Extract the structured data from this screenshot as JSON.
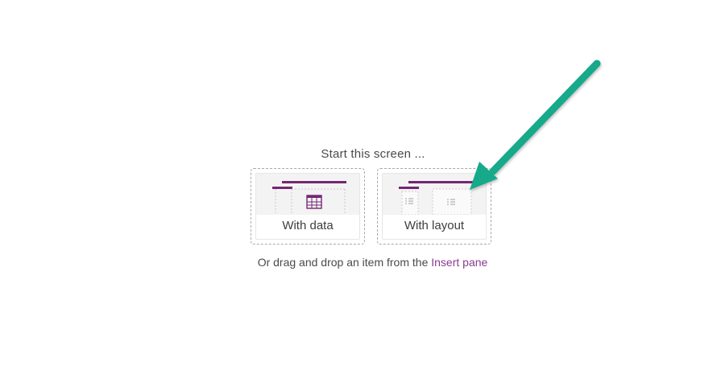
{
  "start": {
    "title": "Start this screen ..."
  },
  "cards": {
    "with_data": {
      "label": "With data",
      "icon": "table-icon"
    },
    "with_layout": {
      "label": "With layout",
      "icon": "layout-icon"
    }
  },
  "footer": {
    "prefix": "Or drag and drop an item from the ",
    "link_label": "Insert pane"
  },
  "colors": {
    "accent_purple": "#742774",
    "link_purple": "#8a3b8f",
    "annotation_arrow": "#14a98a"
  }
}
